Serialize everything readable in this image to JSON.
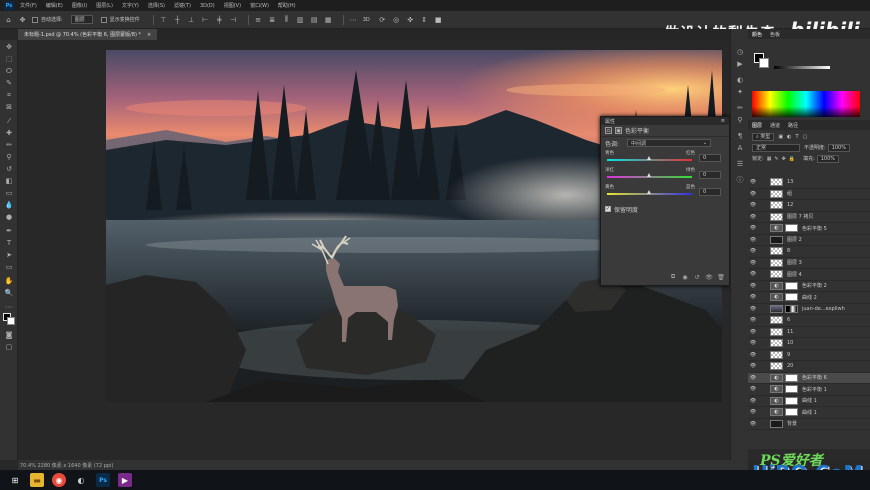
{
  "menubar": {
    "logo": "Ps",
    "items": [
      "文件(F)",
      "编辑(E)",
      "图像(I)",
      "图层(L)",
      "文字(Y)",
      "选择(S)",
      "滤镜(T)",
      "3D(D)",
      "视图(V)",
      "窗口(W)",
      "帮助(H)"
    ]
  },
  "options": {
    "auto_select_label": "自动选择:",
    "auto_select_value": "图层",
    "show_transform_label": "显示变换控件"
  },
  "document": {
    "tab_label": "未标题-1.psd @ 70.4% (色彩平衡 6, 图层蒙版/8) *"
  },
  "properties": {
    "header": "属性",
    "adjustment_name": "色彩平衡",
    "tone_label": "色调:",
    "tone_value": "中间调",
    "sliders": [
      {
        "left": "青色",
        "right": "红色",
        "value": "0",
        "pos": 0.5
      },
      {
        "left": "洋红",
        "right": "绿色",
        "value": "0",
        "pos": 0.5
      },
      {
        "left": "黄色",
        "right": "蓝色",
        "value": "0",
        "pos": 0.5
      }
    ],
    "preserve_label": "保留明度"
  },
  "status": {
    "text": "70.4%      2280 像素 x 1640 像素 (72 ppi)"
  },
  "panels": {
    "top_tabs": [
      "颜色",
      "色板"
    ],
    "layers_tabs": [
      "图层",
      "通道",
      "路径"
    ],
    "kind_label": "类型",
    "blend_mode": "正常",
    "opacity_label": "不透明度:",
    "opacity_value": "100%",
    "lock_label": "锁定:",
    "fill_label": "填充:",
    "fill_value": "100%"
  },
  "layers": [
    {
      "name": "13",
      "thumb": "checker"
    },
    {
      "name": "组",
      "thumb": "checker"
    },
    {
      "name": "12",
      "thumb": "checker"
    },
    {
      "name": "图层 7 拷贝",
      "thumb": "checker"
    },
    {
      "name": "色彩平衡 5",
      "thumb": "adjust"
    },
    {
      "name": "图层 2",
      "thumb": "dark"
    },
    {
      "name": "8",
      "thumb": "checker"
    },
    {
      "name": "图层 3",
      "thumb": "checker"
    },
    {
      "name": "图层 4",
      "thumb": "checker"
    },
    {
      "name": "色彩平衡 2",
      "thumb": "adjust"
    },
    {
      "name": "曲线 2",
      "thumb": "adjust"
    },
    {
      "name": "juan-de...expliwh",
      "thumb": "photo"
    },
    {
      "name": "6",
      "thumb": "checker"
    },
    {
      "name": "11",
      "thumb": "checker"
    },
    {
      "name": "10",
      "thumb": "checker"
    },
    {
      "name": "9",
      "thumb": "checker"
    },
    {
      "name": "20",
      "thumb": "checker"
    },
    {
      "name": "色彩平衡 6",
      "thumb": "adjust",
      "selected": true
    },
    {
      "name": "色彩平衡 1",
      "thumb": "adjust"
    },
    {
      "name": "曲线 1",
      "thumb": "adjust"
    },
    {
      "name": "曲线 1",
      "thumb": "adjust"
    },
    {
      "name": "背景",
      "thumb": "dark"
    }
  ],
  "watermarks": {
    "top_text": "做设计的梨先森",
    "bili_text": "bilibili",
    "bottom_top": "PS爱好者",
    "bottom_main": "UiBQ.CoM"
  },
  "taskbar": {
    "icons": [
      "windows-start",
      "file-explorer",
      "chrome",
      "media",
      "photoshop",
      "player"
    ]
  },
  "colors": {
    "accent": "#31a8ff",
    "panel_bg": "#323232",
    "canvas_bg": "#282828",
    "selected_layer": "#4a4a4a"
  }
}
